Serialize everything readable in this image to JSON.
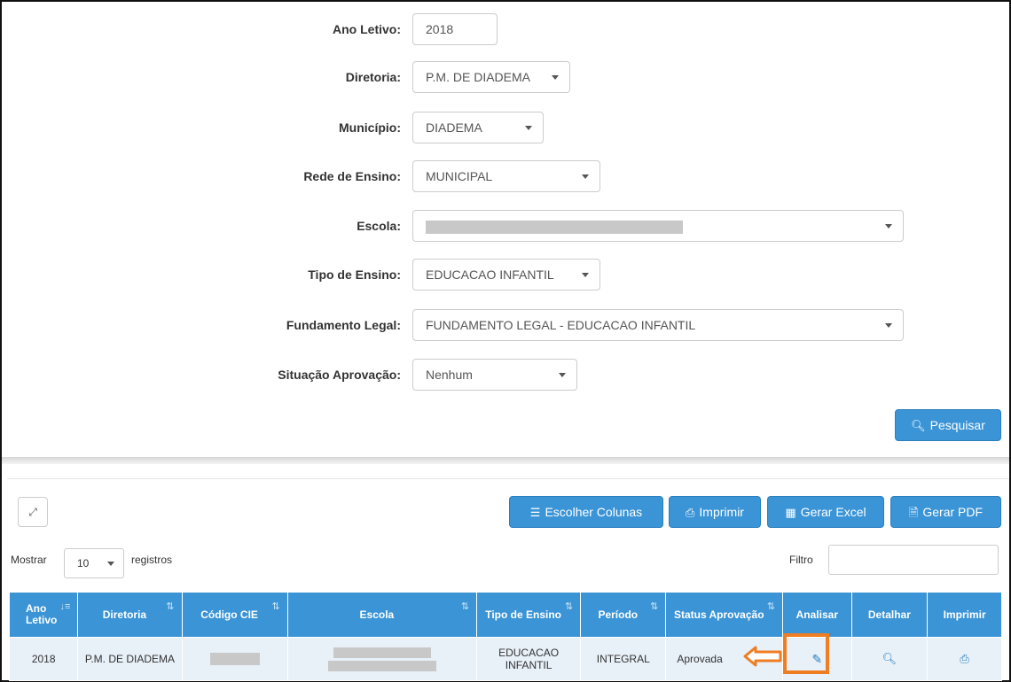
{
  "form": {
    "ano_letivo": {
      "label": "Ano Letivo:",
      "value": "2018"
    },
    "diretoria": {
      "label": "Diretoria:",
      "value": "P.M. DE DIADEMA"
    },
    "municipio": {
      "label": "Município:",
      "value": "DIADEMA"
    },
    "rede_ensino": {
      "label": "Rede de Ensino:",
      "value": "MUNICIPAL"
    },
    "escola": {
      "label": "Escola:",
      "value": ""
    },
    "tipo_ensino": {
      "label": "Tipo de Ensino:",
      "value": "EDUCACAO INFANTIL"
    },
    "fundamento_legal": {
      "label": "Fundamento Legal:",
      "value": "FUNDAMENTO LEGAL - EDUCACAO INFANTIL"
    },
    "situacao_aprovacao": {
      "label": "Situação Aprovação:",
      "value": "Nenhum"
    },
    "search_button": {
      "icon": "search-icon",
      "label": "Pesquisar"
    }
  },
  "toolbar": {
    "expand_icon": "expand-icon",
    "escolher_colunas": {
      "icon": "list-icon",
      "label": "Escolher Colunas"
    },
    "imprimir": {
      "icon": "print-icon",
      "label": "Imprimir"
    },
    "gerar_excel": {
      "icon": "grid-icon",
      "label": "Gerar Excel"
    },
    "gerar_pdf": {
      "icon": "file-icon",
      "label": "Gerar PDF"
    }
  },
  "table_controls": {
    "show_label": "Mostrar",
    "page_length": "10",
    "records_label": "registros",
    "filter_label": "Filtro",
    "filter_value": ""
  },
  "table": {
    "headers": [
      "Ano Letivo",
      "Diretoria",
      "Código CIE",
      "Escola",
      "Tipo de Ensino",
      "Período",
      "Status Aprovação",
      "Analisar",
      "Detalhar",
      "Imprimir"
    ],
    "rows": [
      {
        "ano_letivo": "2018",
        "diretoria": "P.M. DE DIADEMA",
        "codigo_cie": "",
        "escola": "",
        "tipo_ensino": "EDUCACAO INFANTIL",
        "periodo": "INTEGRAL",
        "status_aprovacao": "Aprovada",
        "analisar_icon": "pencil-icon",
        "detalhar_icon": "search-icon",
        "imprimir_icon": "print-icon"
      }
    ]
  },
  "colors": {
    "primary": "#3a94d6",
    "row_bg": "#e8f0f8",
    "highlight": "#ef7d22"
  }
}
